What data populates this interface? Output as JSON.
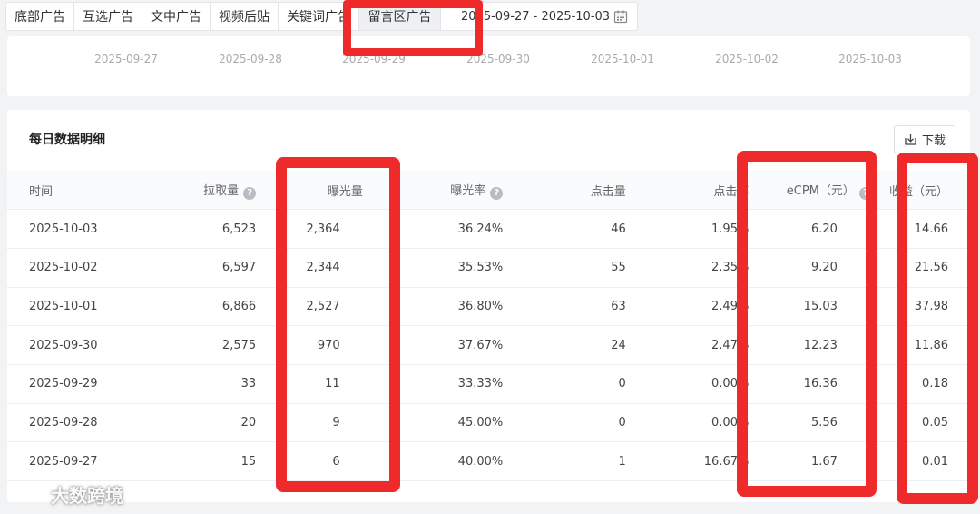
{
  "tabs": [
    {
      "label": "底部广告",
      "active": false
    },
    {
      "label": "互选广告",
      "active": false
    },
    {
      "label": "文中广告",
      "active": false
    },
    {
      "label": "视频后贴",
      "active": false
    },
    {
      "label": "关键词广告",
      "active": false
    },
    {
      "label": "留言区广告",
      "active": true
    }
  ],
  "date_range": {
    "value": "2025-09-27 - 2025-10-03",
    "icon": "calendar-icon"
  },
  "chart": {
    "x_ticks": [
      "2025-09-27",
      "2025-09-28",
      "2025-09-29",
      "2025-09-30",
      "2025-10-01",
      "2025-10-02",
      "2025-10-03"
    ]
  },
  "table_card": {
    "title": "每日数据明细",
    "download_label": "下载",
    "columns": [
      "时间",
      "拉取量",
      "曝光量",
      "曝光率",
      "点击量",
      "点击率",
      "eCPM（元）",
      "收益（元）"
    ],
    "help_icon": "?",
    "rows": [
      [
        "2025-10-03",
        "6,523",
        "2,364",
        "36.24%",
        "46",
        "1.95%",
        "6.20",
        "14.66"
      ],
      [
        "2025-10-02",
        "6,597",
        "2,344",
        "35.53%",
        "55",
        "2.35%",
        "9.20",
        "21.56"
      ],
      [
        "2025-10-01",
        "6,866",
        "2,527",
        "36.80%",
        "63",
        "2.49%",
        "15.03",
        "37.98"
      ],
      [
        "2025-09-30",
        "2,575",
        "970",
        "37.67%",
        "24",
        "2.47%",
        "12.23",
        "11.86"
      ],
      [
        "2025-09-29",
        "33",
        "11",
        "33.33%",
        "0",
        "0.00%",
        "16.36",
        "0.18"
      ],
      [
        "2025-09-28",
        "20",
        "9",
        "45.00%",
        "0",
        "0.00%",
        "5.56",
        "0.05"
      ],
      [
        "2025-09-27",
        "15",
        "6",
        "40.00%",
        "1",
        "16.67%",
        "1.67",
        "0.01"
      ]
    ]
  },
  "watermark": "大数跨境",
  "colors": {
    "highlight": "#ee2a2a",
    "active_tab_bg": "#eef0f3"
  }
}
